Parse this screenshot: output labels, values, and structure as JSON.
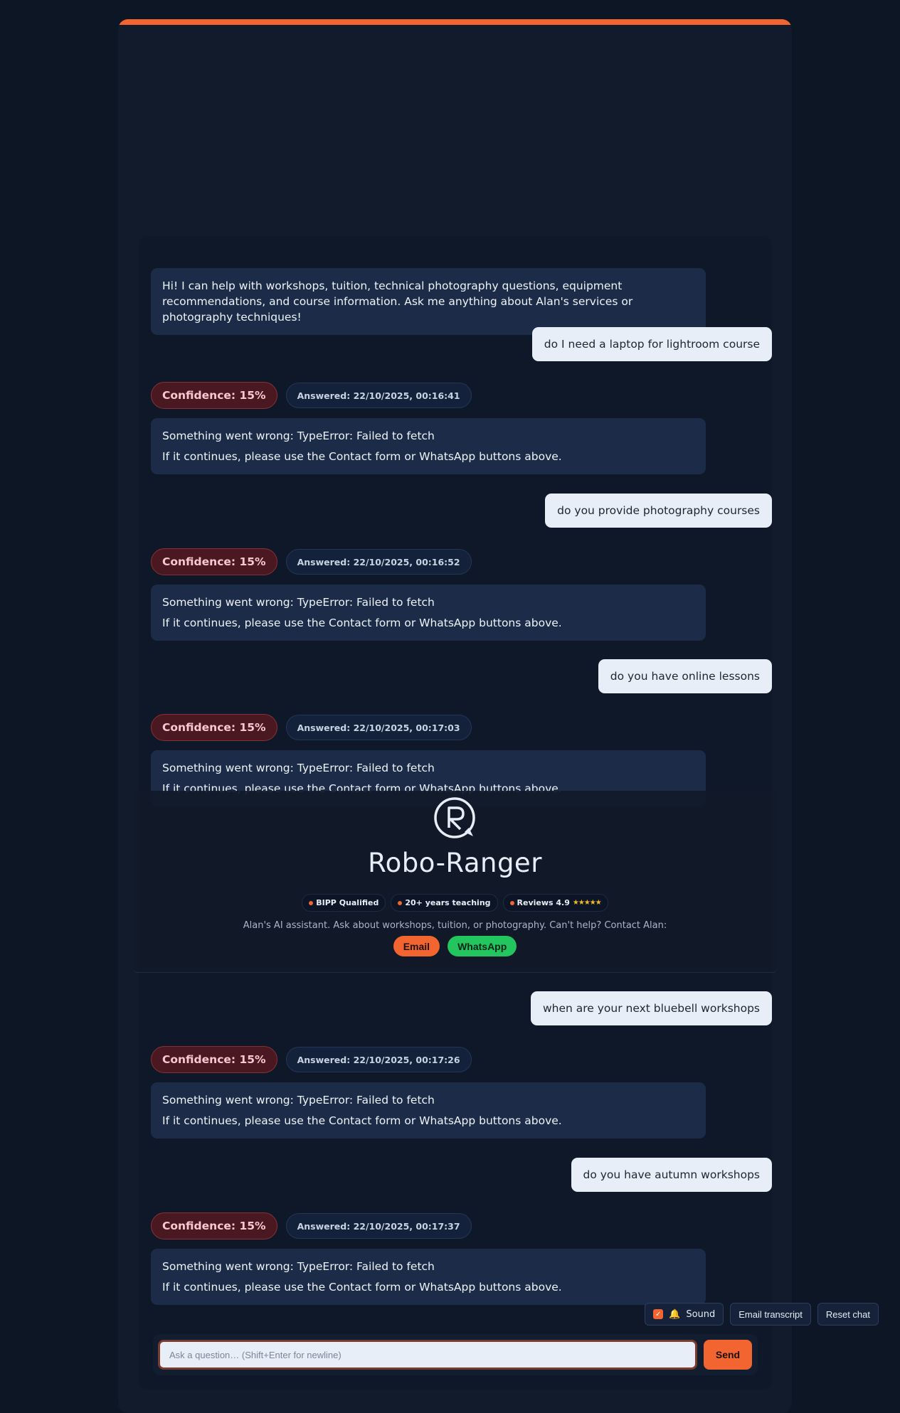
{
  "colors": {
    "accent": "#f26430",
    "background": "#0d1625",
    "bot_bubble": "#1c2b47",
    "user_bubble": "#e8eef7",
    "confidence_bg": "#4a1820",
    "whatsapp": "#22c55e"
  },
  "header": {
    "logo_icon": "chat-bubble-R-logo",
    "title": "Robo-Ranger",
    "tags": [
      {
        "label": "BIPP Qualified"
      },
      {
        "label": "20+ years teaching"
      },
      {
        "label": "Reviews 4.9",
        "stars": "★★★★★"
      }
    ],
    "subtitle": "Alan's AI assistant. Ask about workshops, tuition, or photography. Can't help? Contact Alan:",
    "email_label": "Email",
    "whatsapp_label": "WhatsApp"
  },
  "chat": {
    "intro": "Hi! I can help with workshops, tuition, technical photography questions, equipment recommendations, and course information. Ask me anything about Alan's services or photography techniques!",
    "exchanges": [
      {
        "question": "do I need a laptop for lightroom course",
        "confidence": "Confidence: 15%",
        "answered": "Answered: 22/10/2025, 00:16:41",
        "error": "Something went wrong: TypeError: Failed to fetch",
        "hint": "If it continues, please use the Contact form or WhatsApp buttons above."
      },
      {
        "question": "do you provide photography courses",
        "confidence": "Confidence: 15%",
        "answered": "Answered: 22/10/2025, 00:16:52",
        "error": "Something went wrong: TypeError: Failed to fetch",
        "hint": "If it continues, please use the Contact form or WhatsApp buttons above."
      },
      {
        "question": "do you have online lessons",
        "confidence": "Confidence: 15%",
        "answered": "Answered: 22/10/2025, 00:17:03",
        "error": "Something went wrong: TypeError: Failed to fetch",
        "hint": "If it continues, please use the Contact form or WhatsApp buttons above."
      },
      {
        "question": "when are your next bluebell workshops",
        "confidence": "Confidence: 15%",
        "answered": "Answered: 22/10/2025, 00:17:26",
        "error": "Something went wrong: TypeError: Failed to fetch",
        "hint": "If it continues, please use the Contact form or WhatsApp buttons above."
      },
      {
        "question": "do you have autumn workshops",
        "confidence": "Confidence: 15%",
        "answered": "Answered: 22/10/2025, 00:17:37",
        "error": "Something went wrong: TypeError: Failed to fetch",
        "hint": "If it continues, please use the Contact form or WhatsApp buttons above."
      }
    ]
  },
  "controls": {
    "sound_label": "Sound",
    "sound_checked": true,
    "sound_icon": "bell-icon",
    "email_transcript_label": "Email transcript",
    "reset_label": "Reset chat"
  },
  "composer": {
    "placeholder": "Ask a question… (Shift+Enter for newline)",
    "value": "",
    "send_label": "Send"
  }
}
